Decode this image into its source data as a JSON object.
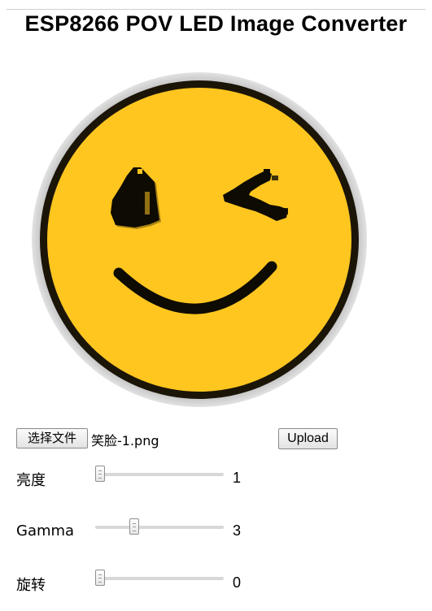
{
  "page": {
    "title": "ESP8266 POV LED Image Converter"
  },
  "preview": {
    "face_color": "#ffc61f",
    "outline_color": "#1b1508",
    "rim_color": "#c8c8c8",
    "feature_color": "#0e0b03"
  },
  "file_input": {
    "button_label": "选择文件",
    "file_name": "笑脸-1.png"
  },
  "upload": {
    "label": "Upload"
  },
  "controls": [
    {
      "label": "亮度",
      "value": "1",
      "min": 1,
      "max": 10,
      "level": 1
    },
    {
      "label": "Gamma",
      "value": "3",
      "min": 1,
      "max": 8,
      "level": 3
    },
    {
      "label": "旋转",
      "value": "0",
      "min": 0,
      "max": 359,
      "level": 0
    }
  ]
}
